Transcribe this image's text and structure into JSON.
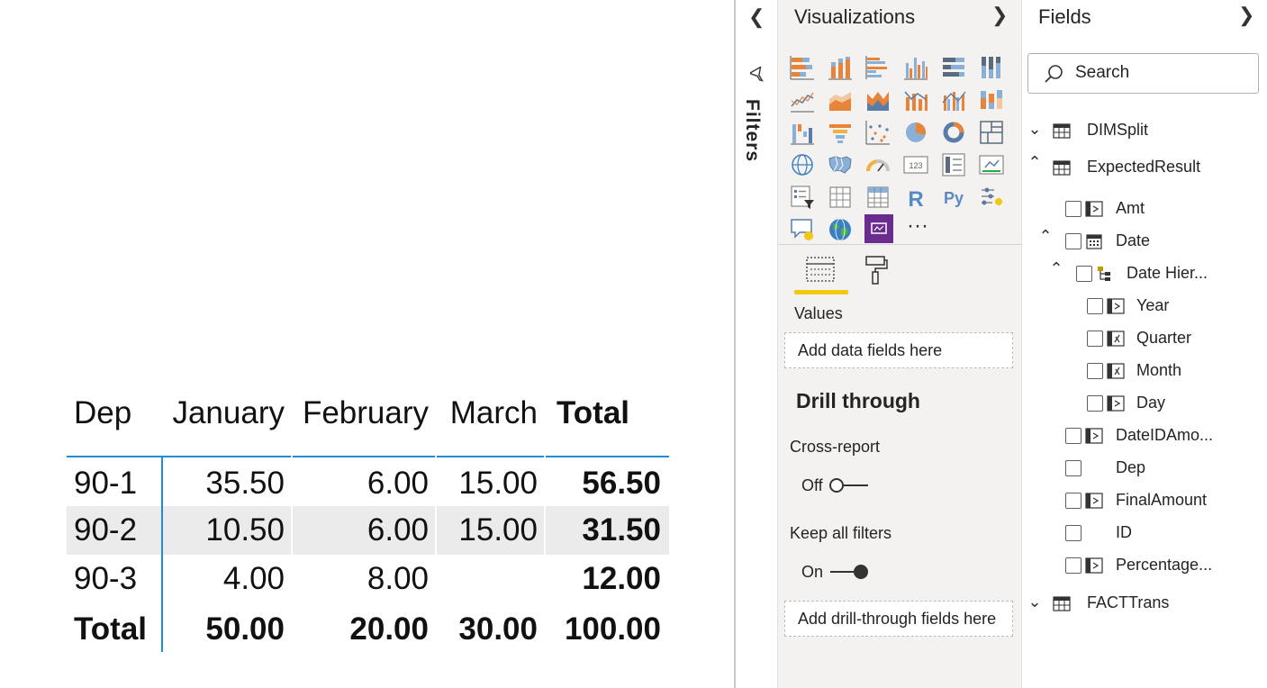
{
  "matrix": {
    "headers": [
      "Dep",
      "January",
      "February",
      "March",
      "Total"
    ],
    "rows": [
      {
        "dep": "90-1",
        "january": "35.50",
        "february": "6.00",
        "march": "15.00",
        "total": "56.50"
      },
      {
        "dep": "90-2",
        "january": "10.50",
        "february": "6.00",
        "march": "15.00",
        "total": "31.50"
      },
      {
        "dep": "90-3",
        "january": "4.00",
        "february": "8.00",
        "march": "",
        "total": "12.00"
      }
    ],
    "totals": {
      "label": "Total",
      "january": "50.00",
      "february": "20.00",
      "march": "30.00",
      "total": "100.00"
    },
    "colors": {
      "accent_line": "#1f8ed6",
      "highlight_row": "#ebebeb"
    }
  },
  "filters": {
    "label": "Filters",
    "collapse_icon": "chevron-left-icon",
    "icon": "funnel-icon"
  },
  "visualizations": {
    "title": "Visualizations",
    "expand_icon": "chevron-right-icon",
    "icons": [
      "stacked-bar-chart-icon",
      "stacked-column-chart-icon",
      "clustered-bar-chart-icon",
      "clustered-column-chart-icon",
      "100-stacked-bar-chart-icon",
      "100-stacked-column-chart-icon",
      "line-chart-icon",
      "area-chart-icon",
      "stacked-area-chart-icon",
      "line-and-stacked-column-chart-icon",
      "line-and-clustered-column-chart-icon",
      "ribbon-chart-icon",
      "waterfall-chart-icon",
      "funnel-chart-icon",
      "scatter-chart-icon",
      "pie-chart-icon",
      "donut-chart-icon",
      "treemap-icon",
      "map-icon",
      "filled-map-icon",
      "gauge-icon",
      "card-icon",
      "multi-row-card-icon",
      "kpi-icon",
      "slicer-icon",
      "table-icon",
      "matrix-icon",
      "r-visual-icon",
      "python-visual-icon",
      "key-influencers-icon",
      "qa-visual-icon",
      "arcgis-map-icon",
      "custom-visual-icon",
      "more-visuals-icon"
    ],
    "r_letter": "R",
    "py_letters": "Py",
    "card_digits": "123",
    "more_dots": "···",
    "tabs": {
      "fields": "fields-tab-icon",
      "format": "paint-roller-icon",
      "active_color": "#f2c811"
    },
    "values_label": "Values",
    "values_placeholder": "Add data fields here",
    "drill_through": {
      "title": "Drill through",
      "cross_report_label": "Cross-report",
      "cross_report_state": "Off",
      "keep_filters_label": "Keep all filters",
      "keep_filters_state": "On",
      "placeholder": "Add drill-through fields here"
    }
  },
  "fields": {
    "title": "Fields",
    "expand_icon": "chevron-right-icon",
    "search_placeholder": "Search",
    "tree": [
      {
        "label": "DIMSplit",
        "type": "table",
        "expanded": false
      },
      {
        "label": "ExpectedResult",
        "type": "table",
        "expanded": true
      },
      {
        "label": "Amt",
        "type": "field"
      },
      {
        "label": "Date",
        "type": "date",
        "expanded": true
      },
      {
        "label": "Date Hier...",
        "type": "hierarchy",
        "expanded": true
      },
      {
        "label": "Year",
        "type": "hierarchy-level"
      },
      {
        "label": "Quarter",
        "type": "hierarchy-level"
      },
      {
        "label": "Month",
        "type": "hierarchy-level"
      },
      {
        "label": "Day",
        "type": "hierarchy-level"
      },
      {
        "label": "DateIDAmo...",
        "type": "field"
      },
      {
        "label": "Dep",
        "type": "field"
      },
      {
        "label": "FinalAmount",
        "type": "field"
      },
      {
        "label": "ID",
        "type": "field"
      },
      {
        "label": "Percentage...",
        "type": "field"
      },
      {
        "label": "FACTTrans",
        "type": "table",
        "expanded": false
      }
    ]
  }
}
